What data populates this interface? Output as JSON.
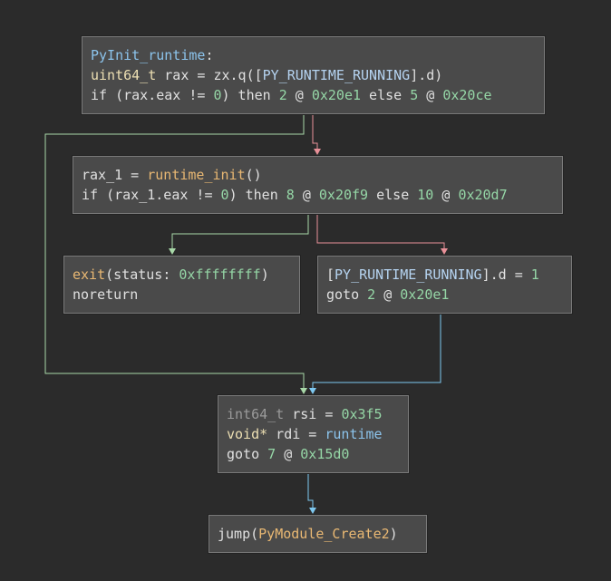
{
  "colors": {
    "background": "#2b2b2b",
    "block_fill": "#4a4a4a",
    "block_border": "#7a7a7a",
    "edge_true": "#a8d8a8",
    "edge_false": "#e89098",
    "edge_unconditional": "#7ec8f0"
  },
  "blocks": [
    {
      "id": "entry",
      "lines": [
        [
          {
            "t": "PyInit_runtime",
            "c": "fname"
          },
          {
            "t": ":",
            "c": "plain"
          }
        ],
        [
          {
            "t": "uint64_t",
            "c": "type"
          },
          {
            "t": " rax = zx.q([",
            "c": "plain"
          },
          {
            "t": "PY_RUNTIME_RUNNING",
            "c": "data"
          },
          {
            "t": "].d)",
            "c": "plain"
          }
        ],
        [
          {
            "t": "if (rax.eax != ",
            "c": "plain"
          },
          {
            "t": "0",
            "c": "num"
          },
          {
            "t": ") then ",
            "c": "plain"
          },
          {
            "t": "2",
            "c": "num"
          },
          {
            "t": " @ ",
            "c": "plain"
          },
          {
            "t": "0x20e1",
            "c": "num"
          },
          {
            "t": " else ",
            "c": "plain"
          },
          {
            "t": "5",
            "c": "num"
          },
          {
            "t": " @ ",
            "c": "plain"
          },
          {
            "t": "0x20ce",
            "c": "num"
          }
        ]
      ]
    },
    {
      "id": "init",
      "lines": [
        [
          {
            "t": "rax_1 = ",
            "c": "plain"
          },
          {
            "t": "runtime_init",
            "c": "func"
          },
          {
            "t": "()",
            "c": "plain"
          }
        ],
        [
          {
            "t": "if (rax_1.eax != ",
            "c": "plain"
          },
          {
            "t": "0",
            "c": "num"
          },
          {
            "t": ") then ",
            "c": "plain"
          },
          {
            "t": "8",
            "c": "num"
          },
          {
            "t": " @ ",
            "c": "plain"
          },
          {
            "t": "0x20f9",
            "c": "num"
          },
          {
            "t": " else ",
            "c": "plain"
          },
          {
            "t": "10",
            "c": "num"
          },
          {
            "t": " @ ",
            "c": "plain"
          },
          {
            "t": "0x20d7",
            "c": "num"
          }
        ]
      ]
    },
    {
      "id": "exit",
      "lines": [
        [
          {
            "t": "exit",
            "c": "func"
          },
          {
            "t": "(status: ",
            "c": "plain"
          },
          {
            "t": "0xffffffff",
            "c": "num"
          },
          {
            "t": ")",
            "c": "plain"
          }
        ],
        [
          {
            "t": "noreturn",
            "c": "plain"
          }
        ]
      ]
    },
    {
      "id": "set_running",
      "lines": [
        [
          {
            "t": "[",
            "c": "plain"
          },
          {
            "t": "PY_RUNTIME_RUNNING",
            "c": "data"
          },
          {
            "t": "].d = ",
            "c": "plain"
          },
          {
            "t": "1",
            "c": "num"
          }
        ],
        [
          {
            "t": "goto ",
            "c": "plain"
          },
          {
            "t": "2",
            "c": "num"
          },
          {
            "t": " @ ",
            "c": "plain"
          },
          {
            "t": "0x20e1",
            "c": "num"
          }
        ]
      ]
    },
    {
      "id": "create_args",
      "lines": [
        [
          {
            "t": "int64_t",
            "c": "type2"
          },
          {
            "t": " rsi = ",
            "c": "plain"
          },
          {
            "t": "0x3f5",
            "c": "num"
          }
        ],
        [
          {
            "t": "void*",
            "c": "type"
          },
          {
            "t": " rdi = ",
            "c": "plain"
          },
          {
            "t": "runtime",
            "c": "fname"
          }
        ],
        [
          {
            "t": "goto ",
            "c": "plain"
          },
          {
            "t": "7",
            "c": "num"
          },
          {
            "t": " @ ",
            "c": "plain"
          },
          {
            "t": "0x15d0",
            "c": "num"
          }
        ]
      ]
    },
    {
      "id": "jump",
      "lines": [
        [
          {
            "t": "jump(",
            "c": "plain"
          },
          {
            "t": "PyModule_Create2",
            "c": "func"
          },
          {
            "t": ")",
            "c": "plain"
          }
        ]
      ]
    }
  ],
  "edges": [
    {
      "from": "entry",
      "to": "create_args",
      "kind": "true"
    },
    {
      "from": "entry",
      "to": "init",
      "kind": "false"
    },
    {
      "from": "init",
      "to": "exit",
      "kind": "true"
    },
    {
      "from": "init",
      "to": "set_running",
      "kind": "false"
    },
    {
      "from": "set_running",
      "to": "create_args",
      "kind": "unconditional"
    },
    {
      "from": "create_args",
      "to": "jump",
      "kind": "unconditional"
    }
  ]
}
